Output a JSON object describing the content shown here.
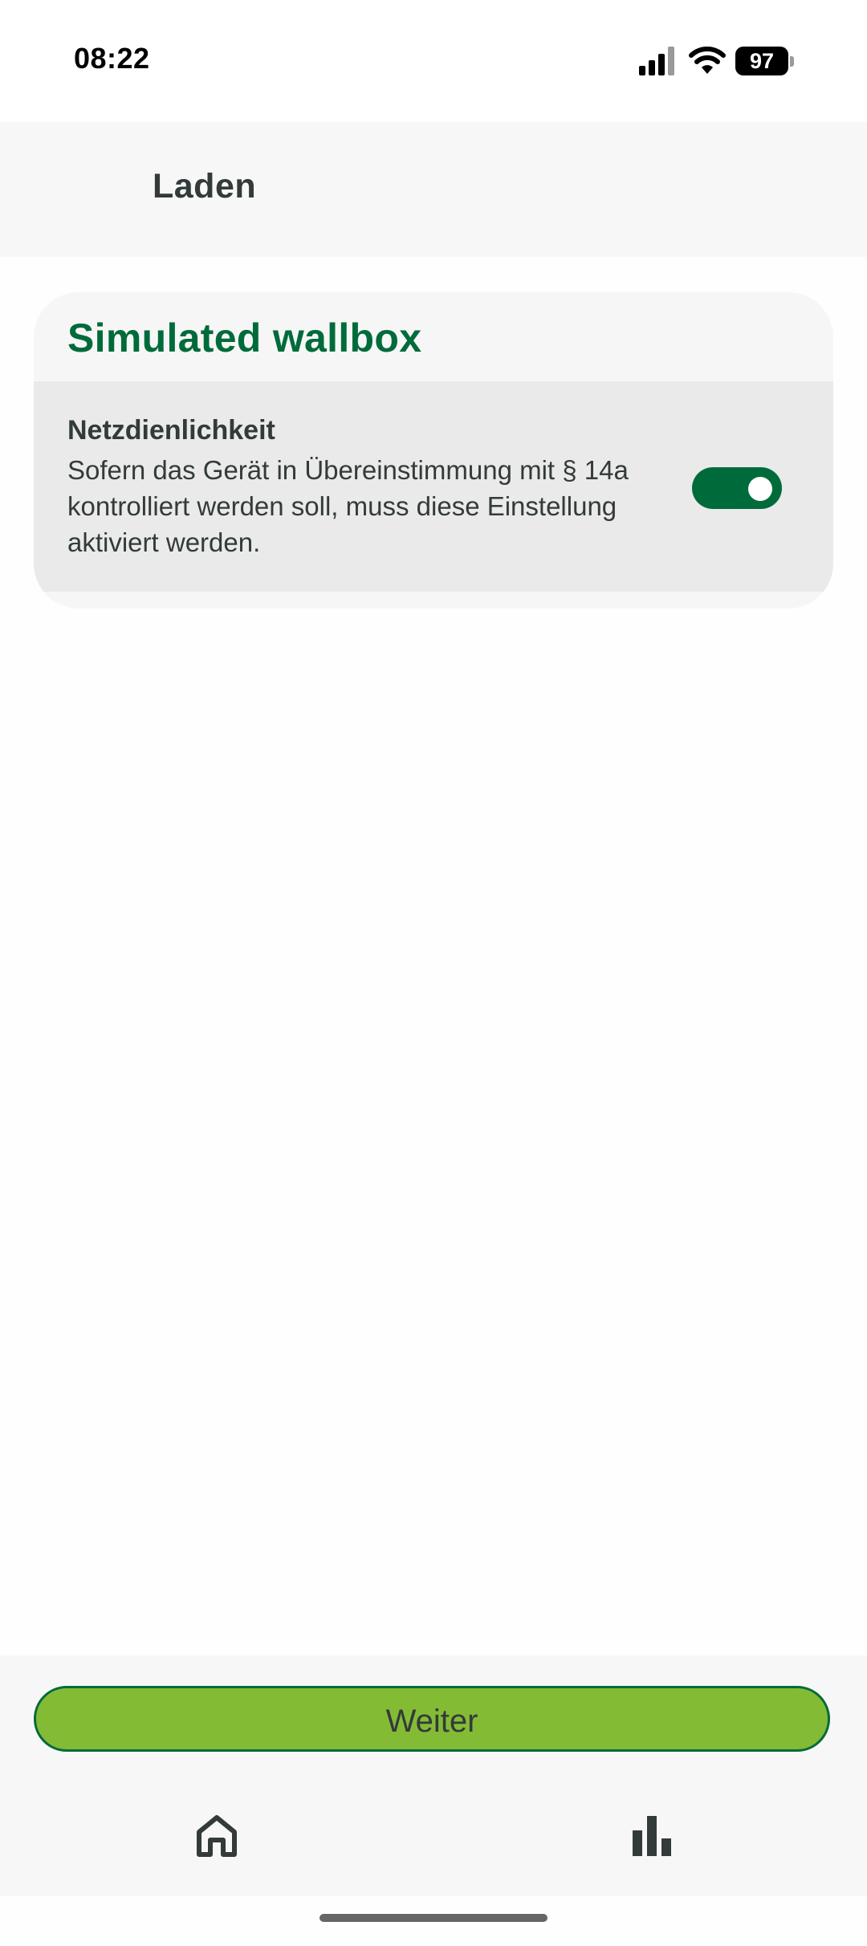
{
  "status_bar": {
    "time": "08:22",
    "battery_level": "97",
    "icons": [
      "cellular-signal-icon",
      "wifi-icon",
      "battery-icon"
    ]
  },
  "header": {
    "title": "Laden"
  },
  "card": {
    "title": "Simulated wallbox",
    "setting": {
      "title": "Netzdienlichkeit",
      "description": "Sofern das Gerät in Übereinstimmung mit § 14a kontrolliert werden soll, muss diese Einstellung aktiviert werden.",
      "enabled": true
    }
  },
  "footer": {
    "button_label": "Weiter"
  },
  "bottom_nav": {
    "items": [
      {
        "icon": "home-icon"
      },
      {
        "icon": "bar-chart-icon"
      }
    ]
  },
  "colors": {
    "brand_green": "#006b3a",
    "button_green": "#84bb34",
    "text": "#333a3a"
  }
}
